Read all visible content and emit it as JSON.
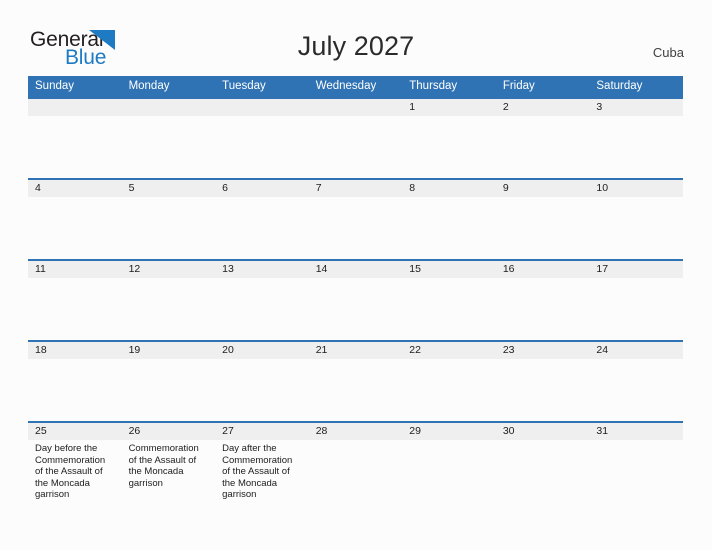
{
  "brand": {
    "name_part1": "General",
    "name_part2": "Blue",
    "triangle_color": "#1f7ac4"
  },
  "header": {
    "title": "July 2027",
    "country": "Cuba"
  },
  "theme": {
    "header_blue": "#2f73b4",
    "row_rule_blue": "#2f73b4",
    "day_band_gray": "#efefef",
    "page_background": "#fcfcfc",
    "text_color": "#1d1d1d"
  },
  "calendar": {
    "weekdays": [
      "Sunday",
      "Monday",
      "Tuesday",
      "Wednesday",
      "Thursday",
      "Friday",
      "Saturday"
    ],
    "weeks": [
      [
        {
          "date": "",
          "events": []
        },
        {
          "date": "",
          "events": []
        },
        {
          "date": "",
          "events": []
        },
        {
          "date": "",
          "events": []
        },
        {
          "date": "1",
          "events": []
        },
        {
          "date": "2",
          "events": []
        },
        {
          "date": "3",
          "events": []
        }
      ],
      [
        {
          "date": "4",
          "events": []
        },
        {
          "date": "5",
          "events": []
        },
        {
          "date": "6",
          "events": []
        },
        {
          "date": "7",
          "events": []
        },
        {
          "date": "8",
          "events": []
        },
        {
          "date": "9",
          "events": []
        },
        {
          "date": "10",
          "events": []
        }
      ],
      [
        {
          "date": "11",
          "events": []
        },
        {
          "date": "12",
          "events": []
        },
        {
          "date": "13",
          "events": []
        },
        {
          "date": "14",
          "events": []
        },
        {
          "date": "15",
          "events": []
        },
        {
          "date": "16",
          "events": []
        },
        {
          "date": "17",
          "events": []
        }
      ],
      [
        {
          "date": "18",
          "events": []
        },
        {
          "date": "19",
          "events": []
        },
        {
          "date": "20",
          "events": []
        },
        {
          "date": "21",
          "events": []
        },
        {
          "date": "22",
          "events": []
        },
        {
          "date": "23",
          "events": []
        },
        {
          "date": "24",
          "events": []
        }
      ],
      [
        {
          "date": "25",
          "events": [
            "Day before the Commemoration of the Assault of the Moncada garrison"
          ]
        },
        {
          "date": "26",
          "events": [
            "Commemoration of the Assault of the Moncada garrison"
          ]
        },
        {
          "date": "27",
          "events": [
            "Day after the Commemoration of the Assault of the Moncada garrison"
          ]
        },
        {
          "date": "28",
          "events": []
        },
        {
          "date": "29",
          "events": []
        },
        {
          "date": "30",
          "events": []
        },
        {
          "date": "31",
          "events": []
        }
      ]
    ]
  }
}
